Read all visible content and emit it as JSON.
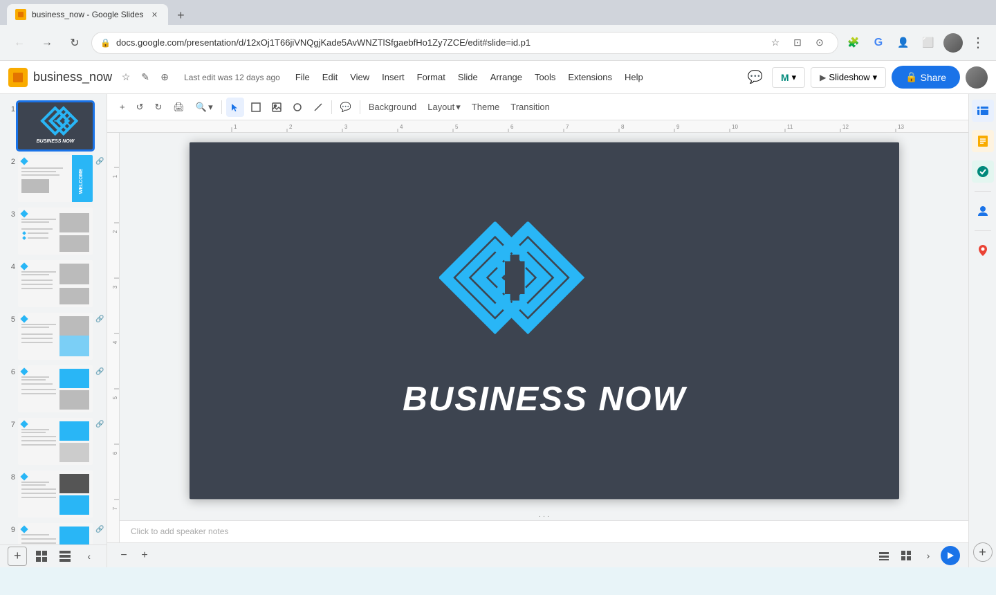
{
  "browser": {
    "tab_title": "business_now - Google Slides",
    "tab_favicon": "slides",
    "url": "docs.google.com/presentation/d/12xOj1T66jiVNQgjKade5AvWNZTlSfgaebfHo1Zy7ZCE/edit#slide=id.p1"
  },
  "app": {
    "file_name": "business_now",
    "edit_status": "Last edit was 12 days ago",
    "menu_items": [
      "File",
      "Edit",
      "View",
      "Insert",
      "Format",
      "Slide",
      "Arrange",
      "Tools",
      "Extensions",
      "Help"
    ]
  },
  "toolbar": {
    "background_label": "Background",
    "layout_label": "Layout",
    "theme_label": "Theme",
    "transition_label": "Transition",
    "slideshow_label": "Slideshow",
    "share_label": "Share"
  },
  "slide": {
    "title": "BUSINESS NOW",
    "background_color": "#3d4450",
    "logo_color": "#29b6f6"
  },
  "slides_panel": {
    "count": 9,
    "items": [
      {
        "num": 1,
        "active": true
      },
      {
        "num": 2,
        "active": false
      },
      {
        "num": 3,
        "active": false
      },
      {
        "num": 4,
        "active": false
      },
      {
        "num": 5,
        "active": false
      },
      {
        "num": 6,
        "active": false
      },
      {
        "num": 7,
        "active": false
      },
      {
        "num": 8,
        "active": false
      },
      {
        "num": 9,
        "active": false
      }
    ]
  },
  "speaker_notes": {
    "placeholder": "Click to add speaker notes"
  },
  "zoom": {
    "level": "Fit"
  },
  "icons": {
    "back": "←",
    "forward": "→",
    "refresh": "↻",
    "star": "☆",
    "lock": "🔒",
    "menu": "⋮",
    "comment": "💬",
    "collapse": "‹",
    "expand": "›",
    "grid": "⊞",
    "list": "≡",
    "plus": "+",
    "minus": "−",
    "chevron_down": "▾",
    "chevron_left": "‹",
    "chevron_right": "›"
  }
}
